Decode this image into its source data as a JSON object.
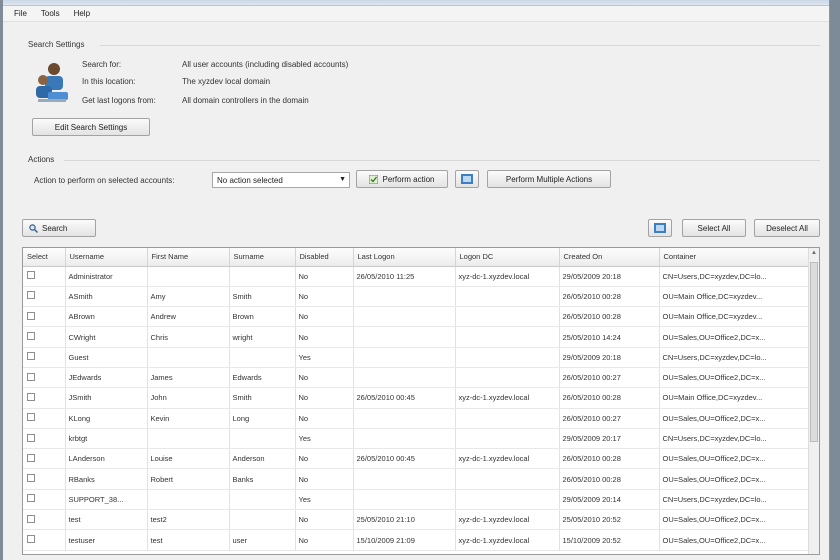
{
  "menu": [
    "File",
    "Tools",
    "Help"
  ],
  "search_settings": {
    "title": "Search Settings",
    "rows": [
      {
        "key": "Search for:",
        "value": "All user accounts (including disabled accounts)"
      },
      {
        "key": "In this location:",
        "value": "The xyzdev local domain"
      },
      {
        "key": "Get last logons from:",
        "value": "All domain controllers in the domain"
      }
    ],
    "edit_button": "Edit Search Settings"
  },
  "actions": {
    "title": "Actions",
    "label": "Action to perform on selected accounts:",
    "select_value": "No action selected",
    "perform_button": "Perform action",
    "multiple_button": "Perform Multiple Actions"
  },
  "toolbar": {
    "search_button": "Search",
    "select_all": "Select All",
    "deselect_all": "Deselect All"
  },
  "grid": {
    "columns": [
      "Select",
      "Username",
      "First Name",
      "Surname",
      "Disabled",
      "Last Logon",
      "Logon DC",
      "Created On",
      "Container"
    ],
    "rows": [
      [
        "",
        "Administrator",
        "",
        "",
        "No",
        "26/05/2010 11:25",
        "xyz-dc-1.xyzdev.local",
        "29/05/2009 20:18",
        "CN=Users,DC=xyzdev,DC=lo..."
      ],
      [
        "",
        "ASmith",
        "Amy",
        "Smith",
        "No",
        "",
        "",
        "26/05/2010 00:28",
        "OU=Main Office,DC=xyzdev..."
      ],
      [
        "",
        "ABrown",
        "Andrew",
        "Brown",
        "No",
        "",
        "",
        "26/05/2010 00:28",
        "OU=Main Office,DC=xyzdev..."
      ],
      [
        "",
        "CWright",
        "Chris",
        "wright",
        "No",
        "",
        "",
        "25/05/2010 14:24",
        "OU=Sales,OU=Office2,DC=x..."
      ],
      [
        "",
        "Guest",
        "",
        "",
        "Yes",
        "",
        "",
        "29/05/2009 20:18",
        "CN=Users,DC=xyzdev,DC=lo..."
      ],
      [
        "",
        "JEdwards",
        "James",
        "Edwards",
        "No",
        "",
        "",
        "26/05/2010 00:27",
        "OU=Sales,OU=Office2,DC=x..."
      ],
      [
        "",
        "JSmith",
        "John",
        "Smith",
        "No",
        "26/05/2010 00:45",
        "xyz-dc-1.xyzdev.local",
        "26/05/2010 00:28",
        "OU=Main Office,DC=xyzdev..."
      ],
      [
        "",
        "KLong",
        "Kevin",
        "Long",
        "No",
        "",
        "",
        "26/05/2010 00:27",
        "OU=Sales,OU=Office2,DC=x..."
      ],
      [
        "",
        "krbtgt",
        "",
        "",
        "Yes",
        "",
        "",
        "29/05/2009 20:17",
        "CN=Users,DC=xyzdev,DC=lo..."
      ],
      [
        "",
        "LAnderson",
        "Louise",
        "Anderson",
        "No",
        "26/05/2010 00:45",
        "xyz-dc-1.xyzdev.local",
        "26/05/2010 00:28",
        "OU=Sales,OU=Office2,DC=x..."
      ],
      [
        "",
        "RBanks",
        "Robert",
        "Banks",
        "No",
        "",
        "",
        "26/05/2010 00:28",
        "OU=Sales,OU=Office2,DC=x..."
      ],
      [
        "",
        "SUPPORT_38...",
        "",
        "",
        "Yes",
        "",
        "",
        "29/05/2009 20:14",
        "CN=Users,DC=xyzdev,DC=lo..."
      ],
      [
        "",
        "test",
        "test2",
        "",
        "No",
        "25/05/2010 21:10",
        "xyz-dc-1.xyzdev.local",
        "25/05/2010 20:52",
        "OU=Sales,OU=Office2,DC=x..."
      ],
      [
        "",
        "testuser",
        "test",
        "user",
        "No",
        "15/10/2009 21:09",
        "xyz-dc-1.xyzdev.local",
        "15/10/2009 20:52",
        "OU=Sales,OU=Office2,DC=x..."
      ]
    ]
  }
}
